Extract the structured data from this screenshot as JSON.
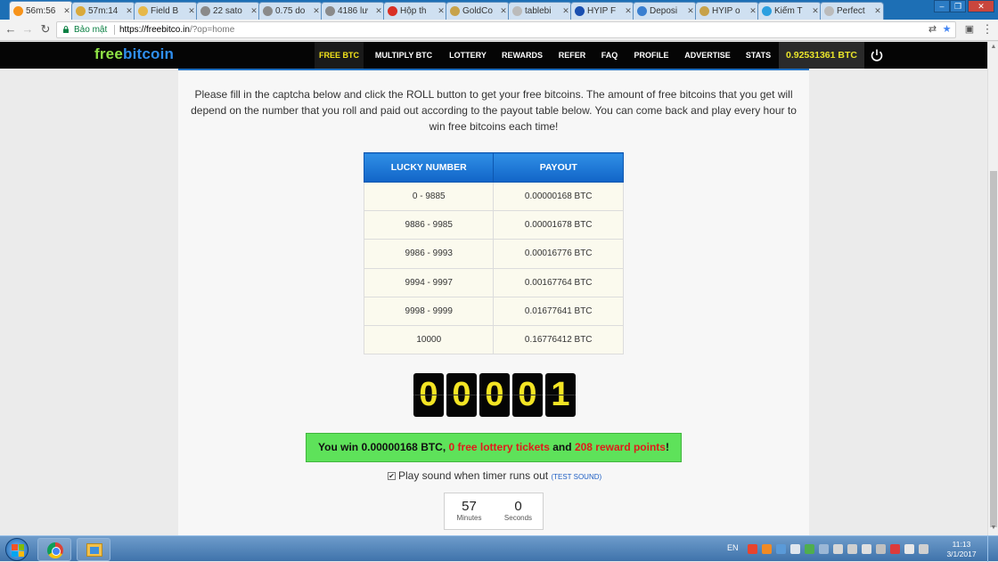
{
  "browser": {
    "tabs": [
      {
        "label": "56m:56",
        "color": "#f7931a",
        "active": true
      },
      {
        "label": "57m:14",
        "color": "#d9a93b"
      },
      {
        "label": "Field B",
        "color": "#e6b84a"
      },
      {
        "label": "22 sato",
        "color": "#8a8a8a"
      },
      {
        "label": "0.75 do",
        "color": "#8a8a8a"
      },
      {
        "label": "4186 lư",
        "color": "#8a8a8a"
      },
      {
        "label": "Hộp th",
        "color": "#d93025"
      },
      {
        "label": "GoldCo",
        "color": "#c7a24a"
      },
      {
        "label": "tablebi",
        "color": "#bbbbbb"
      },
      {
        "label": "HYIP F",
        "color": "#1a4fb0"
      },
      {
        "label": "Deposi",
        "color": "#3a7fd0"
      },
      {
        "label": "HYIP o",
        "color": "#c7a24a"
      },
      {
        "label": "Kiếm T",
        "color": "#2b9fe0"
      },
      {
        "label": "Perfect",
        "color": "#bbbbbb"
      }
    ],
    "secure_label": "Bảo mật",
    "url_host": "https://freebitco.in",
    "url_path": "/?op=home"
  },
  "site": {
    "logo_free": "free",
    "logo_bitcoin": "bitcoin",
    "nav": [
      "FREE BTC",
      "MULTIPLY BTC",
      "LOTTERY",
      "REWARDS",
      "REFER",
      "FAQ",
      "PROFILE",
      "ADVERTISE",
      "STATS"
    ],
    "balance": "0.92531361 BTC"
  },
  "main": {
    "intro": "Please fill in the captcha below and click the ROLL button to get your free bitcoins. The amount of free bitcoins that you get will depend on the number that you roll and paid out according to the payout table below. You can come back and play every hour to win free bitcoins each time!",
    "table": {
      "headers": [
        "LUCKY NUMBER",
        "PAYOUT"
      ],
      "rows": [
        [
          "0 - 9885",
          "0.00000168 BTC"
        ],
        [
          "9886 - 9985",
          "0.00001678 BTC"
        ],
        [
          "9986 - 9993",
          "0.00016776 BTC"
        ],
        [
          "9994 - 9997",
          "0.00167764 BTC"
        ],
        [
          "9998 - 9999",
          "0.01677641 BTC"
        ],
        [
          "10000",
          "0.16776412 BTC"
        ]
      ]
    },
    "roll_digits": [
      "0",
      "0",
      "0",
      "0",
      "1"
    ],
    "win": {
      "prefix": "You win 0.00000168 BTC, ",
      "lottery": "0 free lottery tickets",
      "middle": " and ",
      "reward": "208 reward points",
      "suffix": "!"
    },
    "sound": {
      "checked_mark": "✔",
      "label": "Play sound when timer runs out",
      "test_link": "(TEST SOUND)"
    },
    "timer": {
      "minutes_value": "57",
      "minutes_label": "Minutes",
      "seconds_value": "0",
      "seconds_label": "Seconds"
    }
  },
  "taskbar": {
    "lang": "EN",
    "time": "11:13",
    "date": "3/1/2017"
  }
}
